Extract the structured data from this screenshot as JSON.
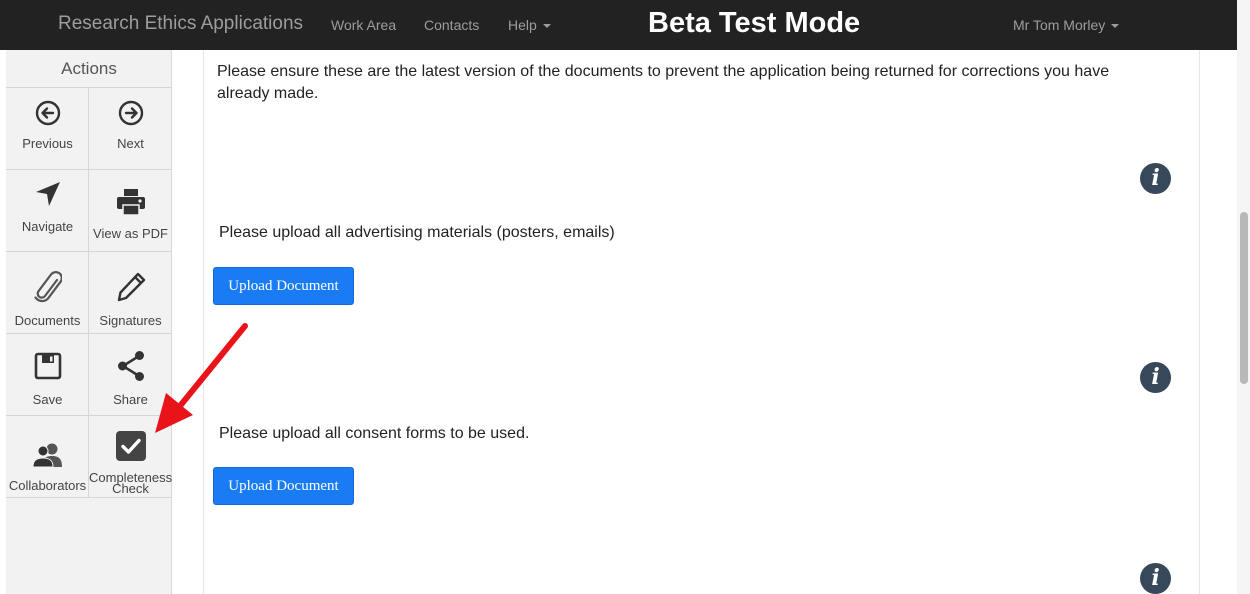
{
  "navbar": {
    "brand": "Research Ethics Applications",
    "links": {
      "work_area": "Work Area",
      "contacts": "Contacts",
      "help": "Help"
    },
    "mode_banner": "Beta Test Mode",
    "user": "Mr Tom Morley"
  },
  "sidebar": {
    "title": "Actions",
    "actions": {
      "previous": "Previous",
      "next": "Next",
      "navigate": "Navigate",
      "view_pdf": "View as PDF",
      "documents": "Documents",
      "signatures": "Signatures",
      "save": "Save",
      "share": "Share",
      "collaborators": "Collaborators",
      "completeness_line1": "Completeness",
      "completeness_line2": "Check"
    }
  },
  "main": {
    "intro_line1": "Please ensure these are the latest version of the documents to prevent the application being returned for corrections you have",
    "intro_line2": "already made.",
    "advertising_prompt": "Please upload all advertising materials (posters, emails)",
    "consent_prompt": "Please upload all consent forms to be used.",
    "upload_label": "Upload Document",
    "info_glyph": "i"
  },
  "colors": {
    "navbar_bg": "#222222",
    "upload_button": "#1a7cf5",
    "info_icon": "#37485a",
    "annotation_arrow": "#e8141a"
  }
}
